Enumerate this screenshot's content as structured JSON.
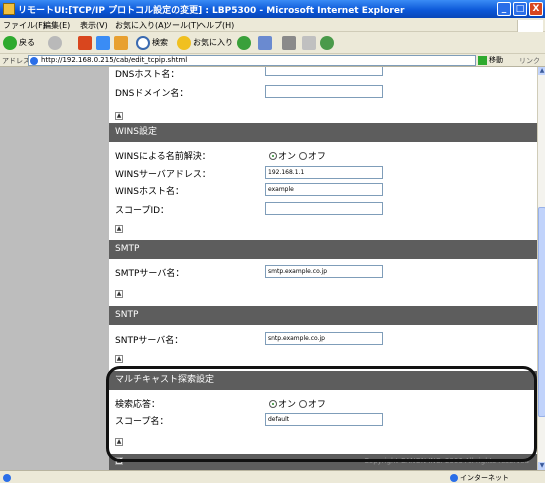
{
  "window": {
    "title": "リモートUI:[TCP/IP プロトコル設定の変更] : LBP5300 - Microsoft Internet Explorer",
    "minimize": "_",
    "maximize": "□",
    "close": "X"
  },
  "menu": [
    "ファイル(F)",
    "編集(E)",
    "表示(V)",
    "お気に入り(A)",
    "ツール(T)",
    "ヘルプ(H)"
  ],
  "toolbar": {
    "back": "戻る",
    "search": "検索",
    "favorites": "お気に入り"
  },
  "address": {
    "label": "アドレス(D)",
    "url": "http://192.168.0.215/cab/edit_tcpip.shtml",
    "go": "移動",
    "links": "リンク"
  },
  "form": {
    "top": {
      "dns_host_label": "DNSホスト名：",
      "dns_domain_label": "DNSドメイン名："
    },
    "wins": {
      "header": "WINS設定",
      "resolve_label": "WINSによる名前解決：",
      "on": "オン",
      "off": "オフ",
      "server_label": "WINSサーバアドレス：",
      "server_value": "192.168.1.1",
      "host_label": "WINSホスト名：",
      "host_value": "example",
      "scope_label": "スコープID：",
      "scope_value": ""
    },
    "smtp": {
      "header": "SMTP",
      "server_label": "SMTPサーバ名：",
      "server_value": "smtp.example.co.jp"
    },
    "sntp": {
      "header": "SNTP",
      "server_label": "SNTPサーバ名：",
      "server_value": "sntp.example.co.jp"
    },
    "multicast": {
      "header": "マルチキャスト探索設定",
      "response_label": "検索応答：",
      "on": "オン",
      "off": "オフ",
      "scope_label": "スコープ名：",
      "scope_value": "default"
    }
  },
  "footer": {
    "copyright": "Copyright CANON INC. 2006 All rights reserved"
  },
  "status": {
    "zone": "インターネット"
  }
}
